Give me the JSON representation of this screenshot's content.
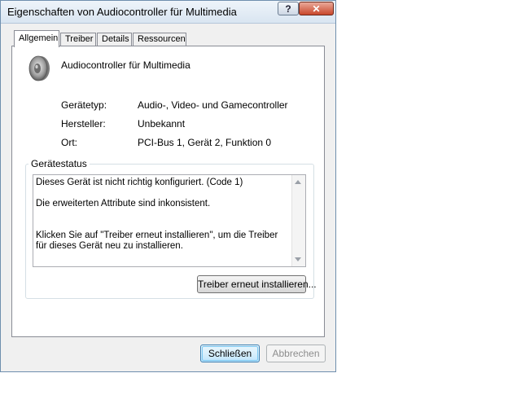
{
  "window": {
    "title": "Eigenschaften von Audiocontroller für Multimedia",
    "help_label": "?",
    "close_label": "✕"
  },
  "tabs": [
    {
      "label": "Allgemein",
      "active": true
    },
    {
      "label": "Treiber",
      "active": false
    },
    {
      "label": "Details",
      "active": false
    },
    {
      "label": "Ressourcen",
      "active": false
    }
  ],
  "device": {
    "icon": "speaker-icon",
    "name": "Audiocontroller für Multimedia"
  },
  "properties": [
    {
      "label": "Gerätetyp:",
      "value": "Audio-, Video- und Gamecontroller"
    },
    {
      "label": "Hersteller:",
      "value": "Unbekannt"
    },
    {
      "label": "Ort:",
      "value": "PCI-Bus 1, Gerät 2, Funktion 0"
    }
  ],
  "status": {
    "group_title": "Gerätestatus",
    "text": "Dieses Gerät ist nicht richtig konfiguriert. (Code 1)\n\nDie erweiterten Attribute sind inkonsistent.\n\n\nKlicken Sie auf \"Treiber erneut installieren\", um die Treiber für dieses Gerät neu zu installieren."
  },
  "buttons": {
    "reinstall": "Treiber erneut installieren...",
    "ok": "Schließen",
    "cancel": "Abbrechen"
  }
}
